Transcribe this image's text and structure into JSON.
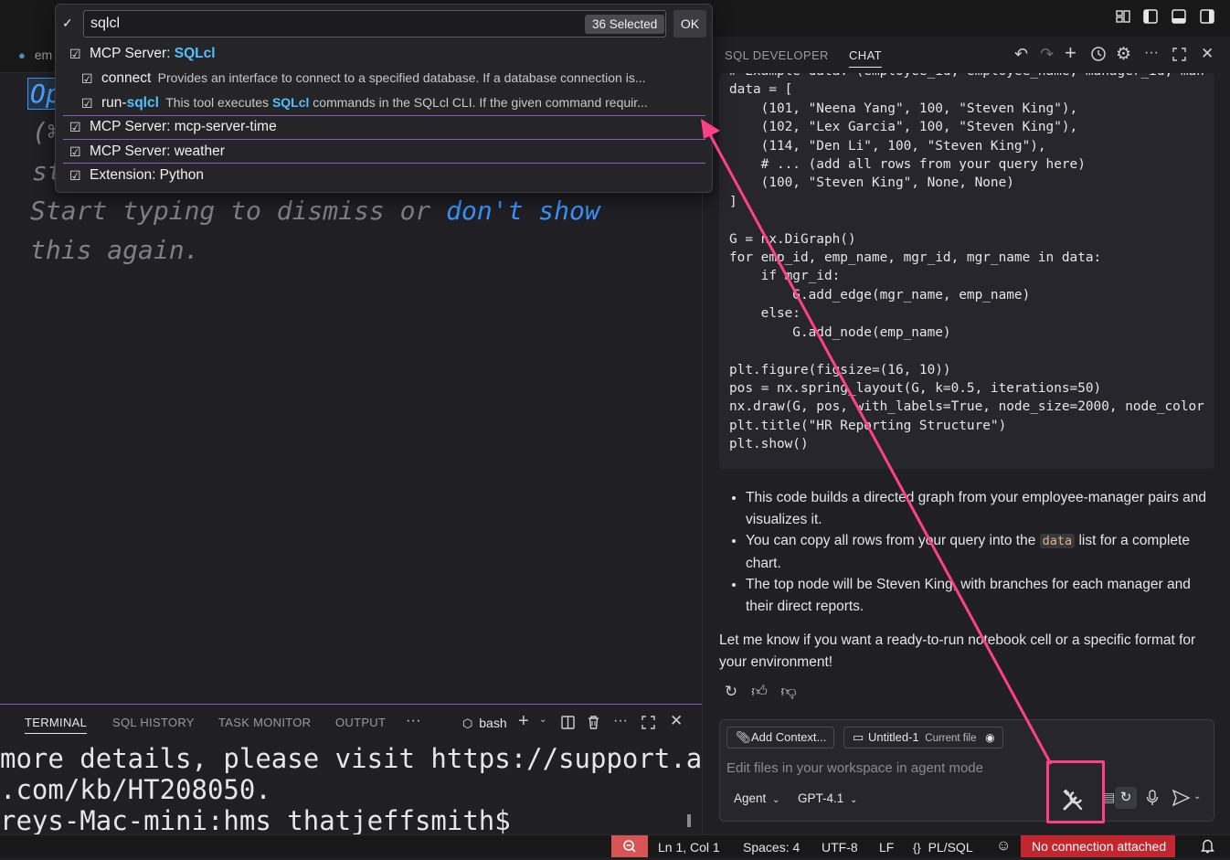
{
  "editor": {
    "tab_label": "em",
    "hint_partial1": "Op",
    "hint_partial2": "(⌘",
    "hint_partial3": "st",
    "hint_line1_prefix": "Start typing to dismiss or ",
    "hint_line1_link": "don't show",
    "hint_line2": "this again."
  },
  "quickpick": {
    "input_value": "sqlcl",
    "selected_badge": "36 Selected",
    "ok_label": "OK",
    "items": [
      {
        "label_prefix": "MCP Server: ",
        "label_highlight": "SQLcl"
      },
      {
        "label": "connect",
        "description": "Provides an interface to connect to a specified database. If a database connection is..."
      },
      {
        "label_prefix": "run-",
        "label_highlight": "sqlcl",
        "description_prefix": "This tool executes ",
        "description_highlight": "SQLcl",
        "description_suffix": " commands in the SQLcl CLI. If the given command requir..."
      },
      {
        "label": "MCP Server: mcp-server-time"
      },
      {
        "label": "MCP Server: weather"
      },
      {
        "label": "Extension: Python"
      }
    ]
  },
  "panel": {
    "tabs": [
      "TERMINAL",
      "SQL HISTORY",
      "TASK MONITOR",
      "OUTPUT"
    ],
    "more": "···",
    "shell": "bash",
    "terminal_lines": [
      "more details, please visit https://support.a",
      ".com/kb/HT208050.",
      "reys-Mac-mini:hms thatjeffsmith$ "
    ]
  },
  "chat": {
    "tabs": [
      "SQL DEVELOPER",
      "CHAT"
    ],
    "code": "# Example data: (employee_id, employee_name, manager_id, man\ndata = [\n    (101, \"Neena Yang\", 100, \"Steven King\"),\n    (102, \"Lex Garcia\", 100, \"Steven King\"),\n    (114, \"Den Li\", 100, \"Steven King\"),\n    # ... (add all rows from your query here)\n    (100, \"Steven King\", None, None)\n]\n\nG = nx.DiGraph()\nfor emp_id, emp_name, mgr_id, mgr_name in data:\n    if mgr_id:\n        G.add_edge(mgr_name, emp_name)\n    else:\n        G.add_node(emp_name)\n\nplt.figure(figsize=(16, 10))\npos = nx.spring_layout(G, k=0.5, iterations=50)\nnx.draw(G, pos, with_labels=True, node_size=2000, node_color\nplt.title(\"HR Reporting Structure\")\nplt.show()",
    "bullet1": "This code builds a directed graph from your employee-manager pairs and visualizes it.",
    "bullet2_prefix": "You can copy all rows from your query into the ",
    "bullet2_code": "data",
    "bullet2_suffix": " list for a complete chart.",
    "bullet3": "The top node will be Steven King, with branches for each manager and their direct reports.",
    "closing": "Let me know if you want a ready-to-run notebook cell or a specific format for your environment!",
    "add_context": "Add Context...",
    "file_chip": "Untitled-1",
    "file_chip_sub": "Current file",
    "input_placeholder": "Edit files in your workspace in agent mode",
    "mode": "Agent",
    "model": "GPT-4.1"
  },
  "statusbar": {
    "position": "Ln 1, Col 1",
    "spaces": "Spaces: 4",
    "encoding": "UTF-8",
    "eol": "LF",
    "language": "PL/SQL",
    "connection": "No connection attached"
  },
  "colors": {
    "accent": "#3794ff",
    "annotation": "#ff3f8a",
    "highlight": "#4fc1ff",
    "error": "#c3262f"
  }
}
